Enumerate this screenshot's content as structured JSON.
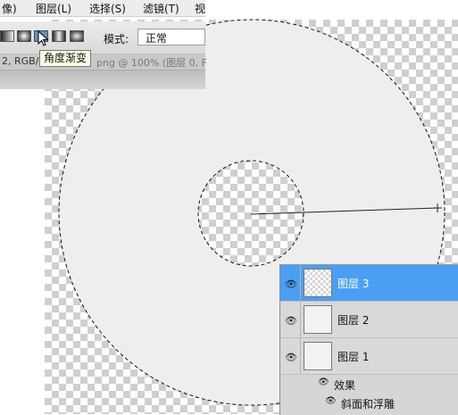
{
  "menubar": {
    "items": [
      "像)",
      "图层(L)",
      "选择(S)",
      "滤镜(T)",
      "视"
    ]
  },
  "options_bar": {
    "gradient_buttons": [
      "linear-gradient",
      "radial-gradient",
      "angle-gradient",
      "reflected-gradient",
      "diamond-gradient"
    ],
    "selected_gradient": "angle-gradient",
    "mode_label": "模式:",
    "mode_value": "正常"
  },
  "document_tab": {
    "left_text": "2, RGB/",
    "right_text": "png @ 100% (图层 0, F"
  },
  "tooltip": {
    "text": "角度渐变"
  },
  "layers_panel": {
    "layers": [
      {
        "name": "图层 3",
        "selected": true,
        "visible": true
      },
      {
        "name": "图层 2",
        "selected": false,
        "visible": true
      },
      {
        "name": "图层 1",
        "selected": false,
        "visible": true
      }
    ],
    "effects_label": "效果",
    "effect_item": "斜面和浮雕"
  },
  "colors": {
    "selection_highlight": "#4b9ff2",
    "canvas_fill": "#eeeeee",
    "tooltip_bg": "#fdfde4"
  }
}
